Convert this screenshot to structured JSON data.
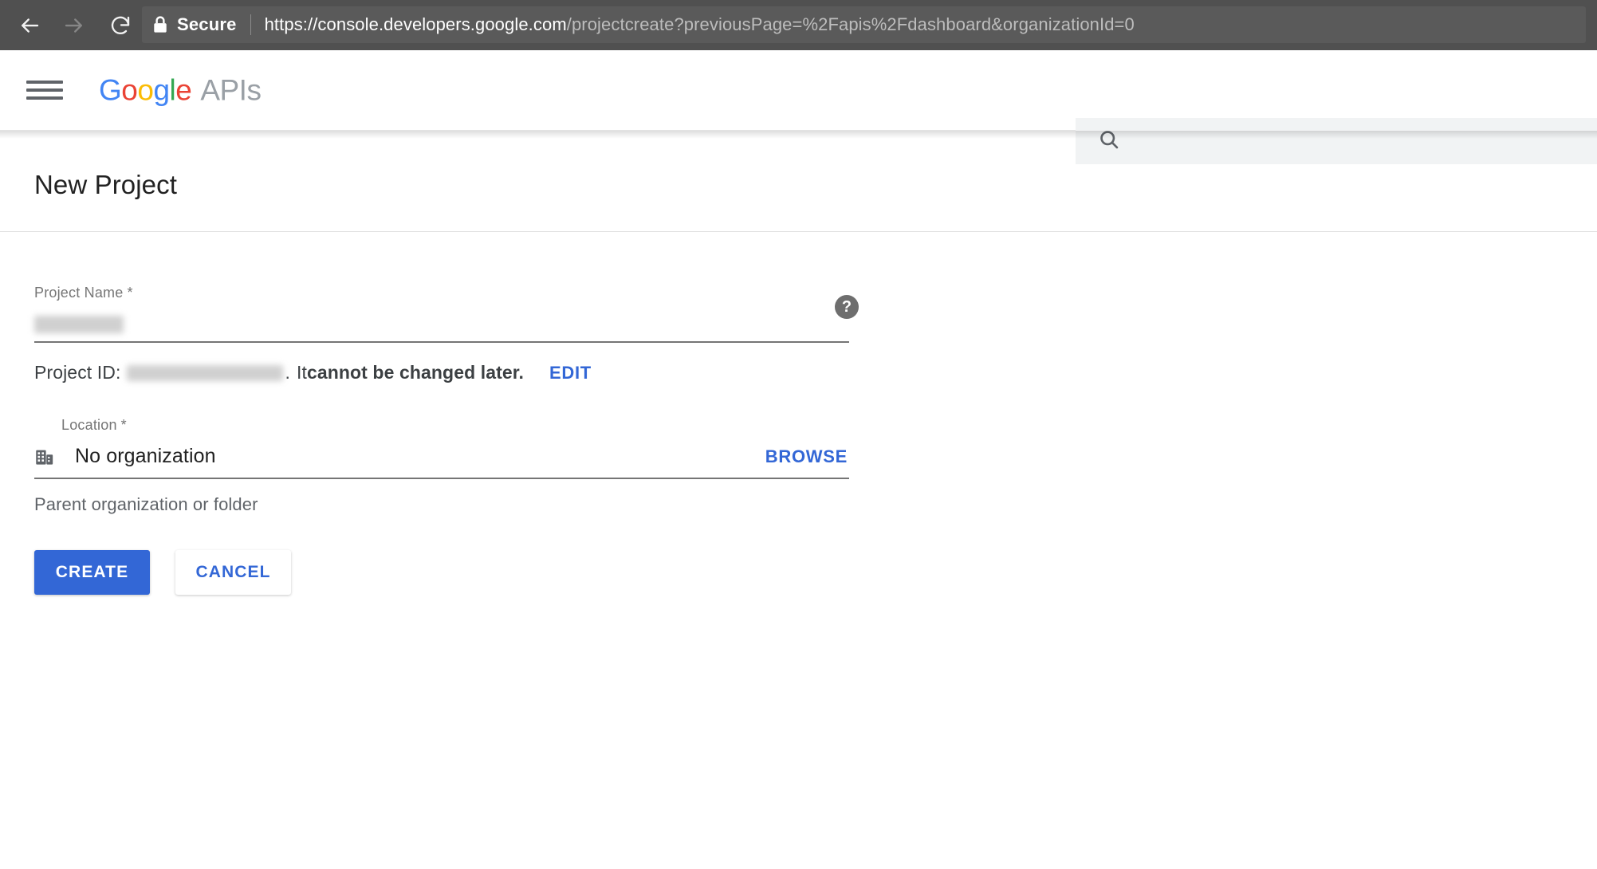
{
  "browser": {
    "back_icon": "arrow-left-icon",
    "forward_icon": "arrow-right-icon",
    "reload_icon": "reload-icon",
    "lock_icon": "lock-icon",
    "security_label": "Secure",
    "url_origin": "https://console.developers.google.com",
    "url_path": "/projectcreate?previousPage=%2Fapis%2Fdashboard&organizationId=0",
    "url_full": "https://console.developers.google.com/projectcreate?previousPage=%2Fapis%2Fdashboard&organizationId=0",
    "chrome_bg": "#505050",
    "omnibox_bg": "#5a5a5a"
  },
  "header": {
    "menu_icon": "hamburger-menu-icon",
    "brand": {
      "letters": [
        "G",
        "o",
        "o",
        "g",
        "l",
        "e"
      ],
      "suffix": "APIs",
      "colors": {
        "blue": "#4285F4",
        "red": "#EA4335",
        "yellow": "#FBBC05",
        "green": "#34A853",
        "gray": "#9aa0a6"
      }
    },
    "search": {
      "icon": "search-icon",
      "value": "",
      "placeholder": ""
    }
  },
  "page": {
    "title": "New Project"
  },
  "form": {
    "project_name": {
      "label": "Project Name",
      "required_marker": "*",
      "value": "",
      "placeholder": "",
      "redacted": true,
      "help_icon": "help-circle-icon",
      "help_glyph": "?"
    },
    "project_id": {
      "prefix": "Project ID:",
      "value": "",
      "redacted": true,
      "suffix_period": ".",
      "note_lead": "It ",
      "note_strong": "cannot be changed later.",
      "edit_label": "EDIT"
    },
    "location": {
      "label": "Location",
      "required_marker": "*",
      "icon": "organization-building-icon",
      "value": "No organization",
      "browse_label": "BROWSE",
      "helper_text": "Parent organization or folder"
    }
  },
  "actions": {
    "create_label": "CREATE",
    "cancel_label": "CANCEL",
    "primary_color": "#3367D6"
  }
}
